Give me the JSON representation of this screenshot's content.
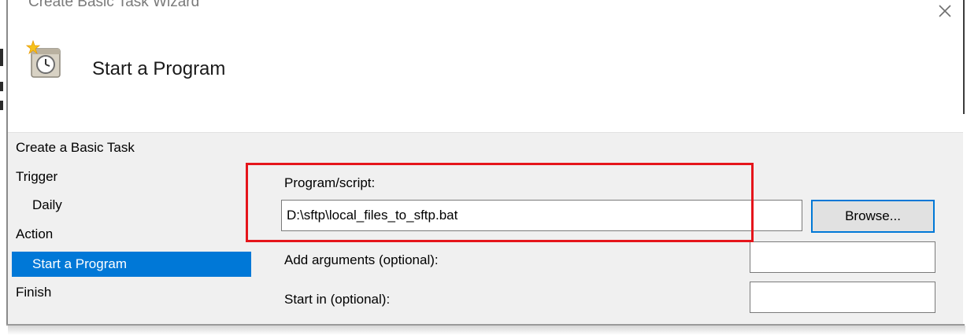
{
  "window": {
    "title": "Create Basic Task Wizard"
  },
  "header": {
    "title": "Start a Program",
    "icon": "task-scheduler-clock-icon"
  },
  "nav": {
    "items": [
      {
        "label": "Create a Basic Task"
      },
      {
        "label": "Trigger"
      },
      {
        "label": "Daily"
      },
      {
        "label": "Action"
      },
      {
        "label": "Start a Program",
        "selected": true
      },
      {
        "label": "Finish"
      }
    ]
  },
  "form": {
    "program_label": "Program/script:",
    "program_value": "D:\\sftp\\local_files_to_sftp.bat",
    "browse_label": "Browse...",
    "arguments_label": "Add arguments (optional):",
    "arguments_value": "",
    "start_in_label": "Start in (optional):",
    "start_in_value": ""
  },
  "colors": {
    "selection": "#0078d7",
    "annotation": "#e5151b",
    "body_background": "#f0f0f0"
  }
}
